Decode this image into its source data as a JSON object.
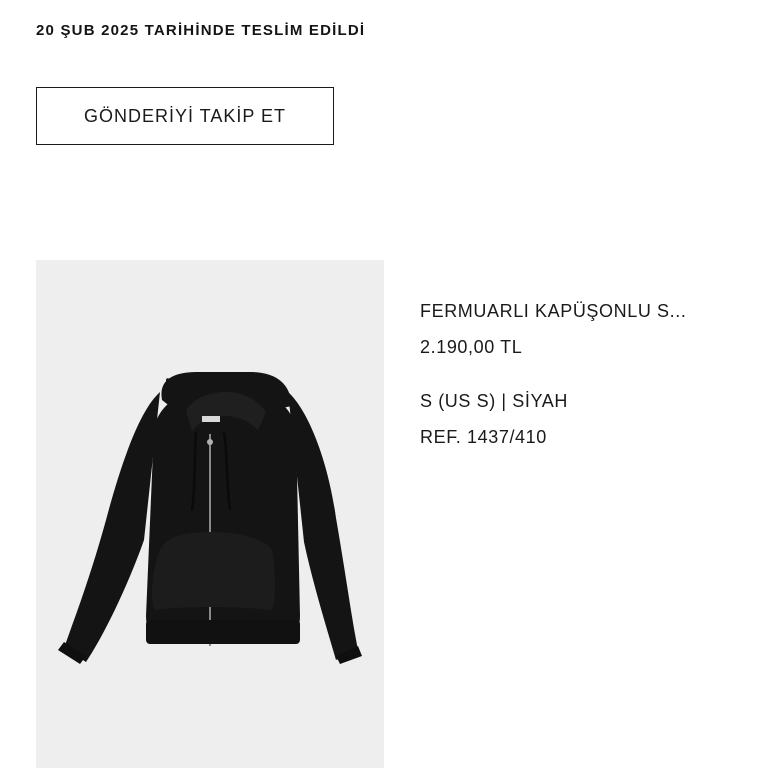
{
  "order": {
    "delivery_status": "20 ŞUB 2025 TARİHİNDE TESLİM EDİLDİ",
    "track_button_label": "GÖNDERİYİ TAKİP ET"
  },
  "product": {
    "image_icon": "black-zip-hoodie-photo",
    "name": "FERMUARLI KAPÜŞONLU S...",
    "price": "2.190,00 TL",
    "variant": "S (US S) | SİYAH",
    "reference": "REF. 1437/410"
  },
  "colors": {
    "background": "#ffffff",
    "image_background": "#eeeeee",
    "text": "#141414",
    "garment": "#141414"
  }
}
